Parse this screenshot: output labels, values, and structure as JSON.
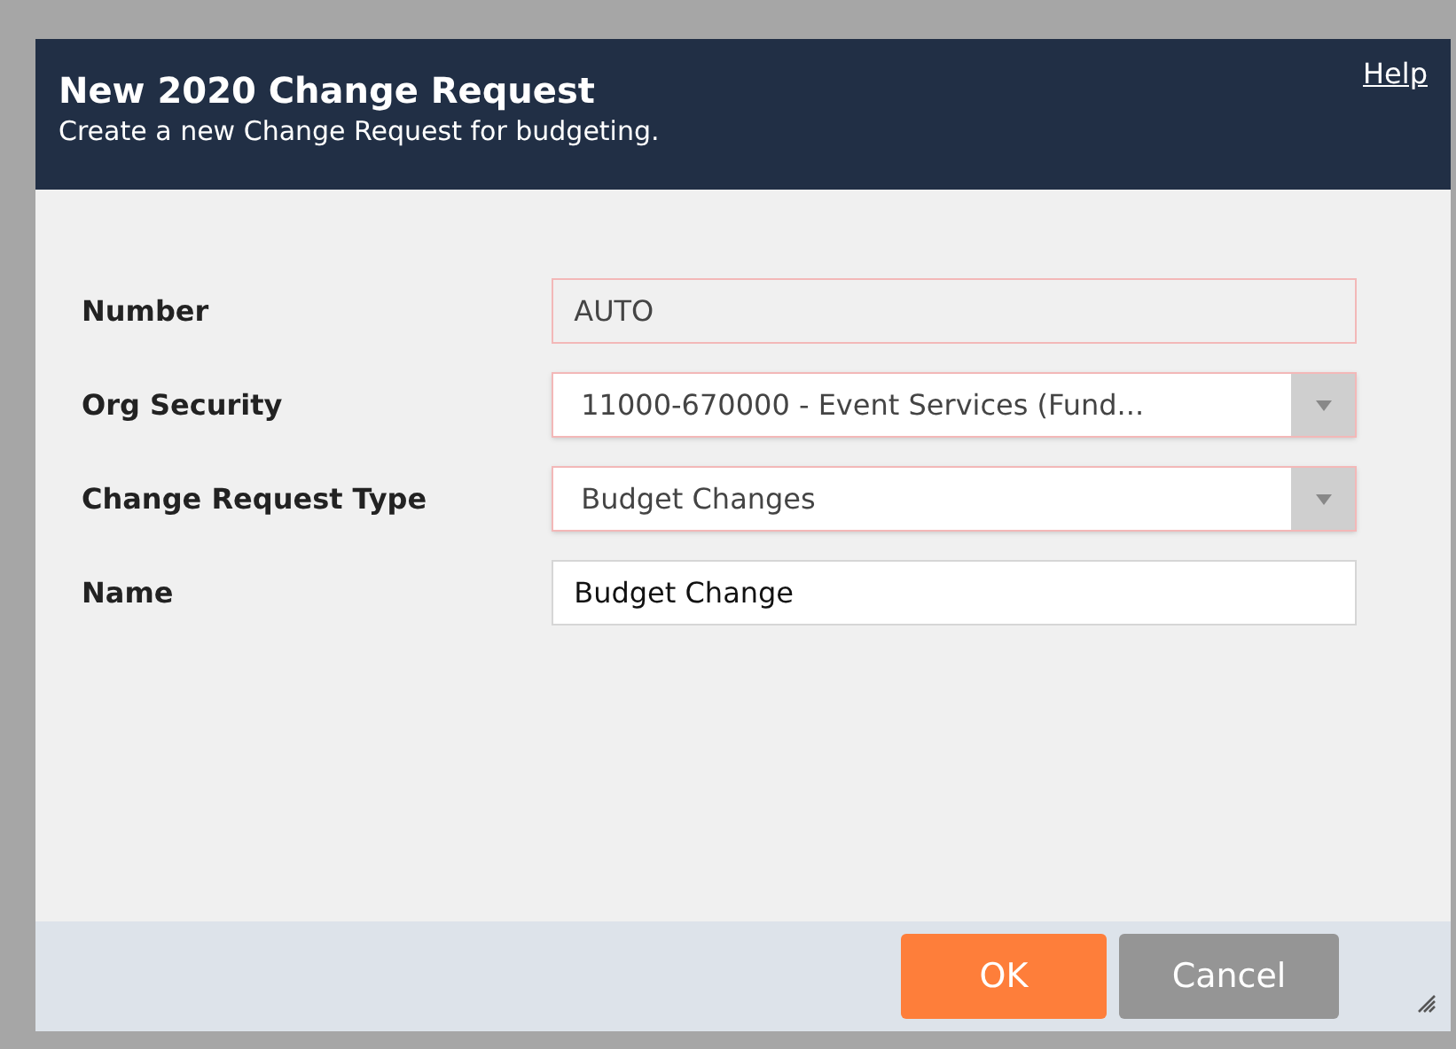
{
  "dialog": {
    "title": "New 2020 Change Request",
    "subtitle": "Create a new Change Request for budgeting.",
    "help_link": "Help"
  },
  "fields": [
    {
      "label": "Number",
      "kind": "readonly",
      "value": "AUTO",
      "required": true
    },
    {
      "label": "Org Security",
      "kind": "select",
      "value": "11000-670000 - Event Services (Fund...",
      "required": true
    },
    {
      "label": "Change Request Type",
      "kind": "select",
      "value": "Budget Changes",
      "required": true
    },
    {
      "label": "Name",
      "kind": "text",
      "value": "Budget Change",
      "required": false
    }
  ],
  "buttons": [
    {
      "label": "OK",
      "kind": "primary"
    },
    {
      "label": "Cancel",
      "kind": "secondary"
    }
  ]
}
